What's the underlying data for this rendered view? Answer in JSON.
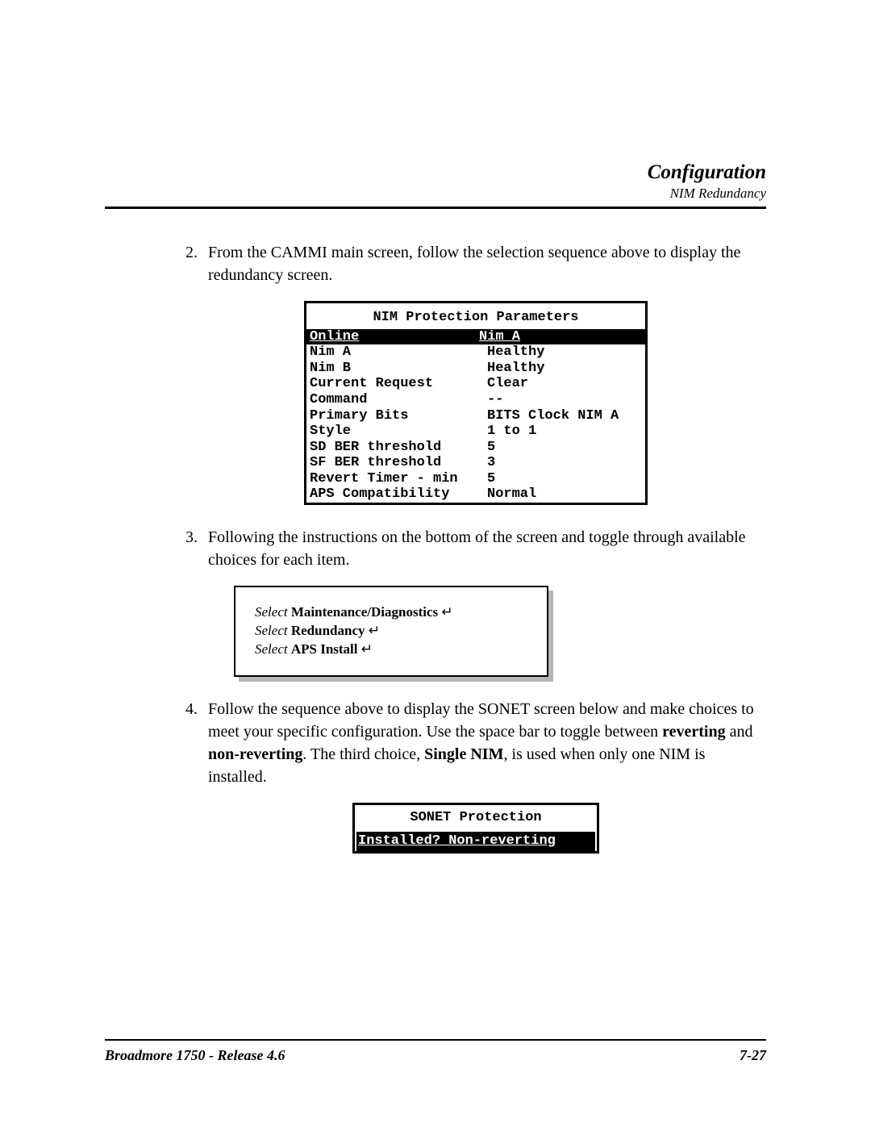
{
  "header": {
    "title": "Configuration",
    "subtitle": "NIM Redundancy"
  },
  "steps": {
    "s2": {
      "num": "2.",
      "text": "From the CAMMI main screen, follow the selection sequence above to display the redundancy screen."
    },
    "s3": {
      "num": "3.",
      "text": "Following the instructions on the bottom of the screen and toggle through available choices for each item."
    },
    "s4": {
      "num": "4.",
      "text_a": "Follow the sequence above to display the SONET screen below and make choices to meet your specific configuration. Use the space bar to toggle between ",
      "bold_a": "reverting",
      "text_b": " and ",
      "bold_b": "non-reverting",
      "text_c": ". The third choice, ",
      "bold_c": "Single NIM",
      "text_d": ", is used when only one NIM is installed."
    }
  },
  "nim": {
    "title": "NIM Protection Parameters",
    "rows": [
      {
        "label": "Online",
        "value": "Nim A",
        "highlight": true
      },
      {
        "label": "Nim A",
        "value": "Healthy",
        "highlight": false
      },
      {
        "label": "Nim B",
        "value": "Healthy",
        "highlight": false
      },
      {
        "label": "Current Request",
        "value": "Clear",
        "highlight": false
      },
      {
        "label": "Command",
        "value": "--",
        "highlight": false
      },
      {
        "label": "Primary Bits",
        "value": "BITS Clock NIM A",
        "highlight": false
      },
      {
        "label": "Style",
        "value": "1 to 1",
        "highlight": false
      },
      {
        "label": "SD BER threshold",
        "value": "5",
        "highlight": false
      },
      {
        "label": "SF BER threshold",
        "value": "3",
        "highlight": false
      },
      {
        "label": "Revert Timer - min",
        "value": "5",
        "highlight": false
      },
      {
        "label": "APS Compatibility",
        "value": "Normal",
        "highlight": false
      }
    ]
  },
  "select": {
    "word": "Select",
    "lines": [
      "Maintenance/Diagnostics",
      "Redundancy",
      "APS Install"
    ],
    "enter": "↵"
  },
  "sonet": {
    "title": "SONET Protection",
    "label": "Installed?",
    "value": "Non-reverting"
  },
  "footer": {
    "left": "Broadmore 1750 - Release 4.6",
    "right": "7-27"
  }
}
